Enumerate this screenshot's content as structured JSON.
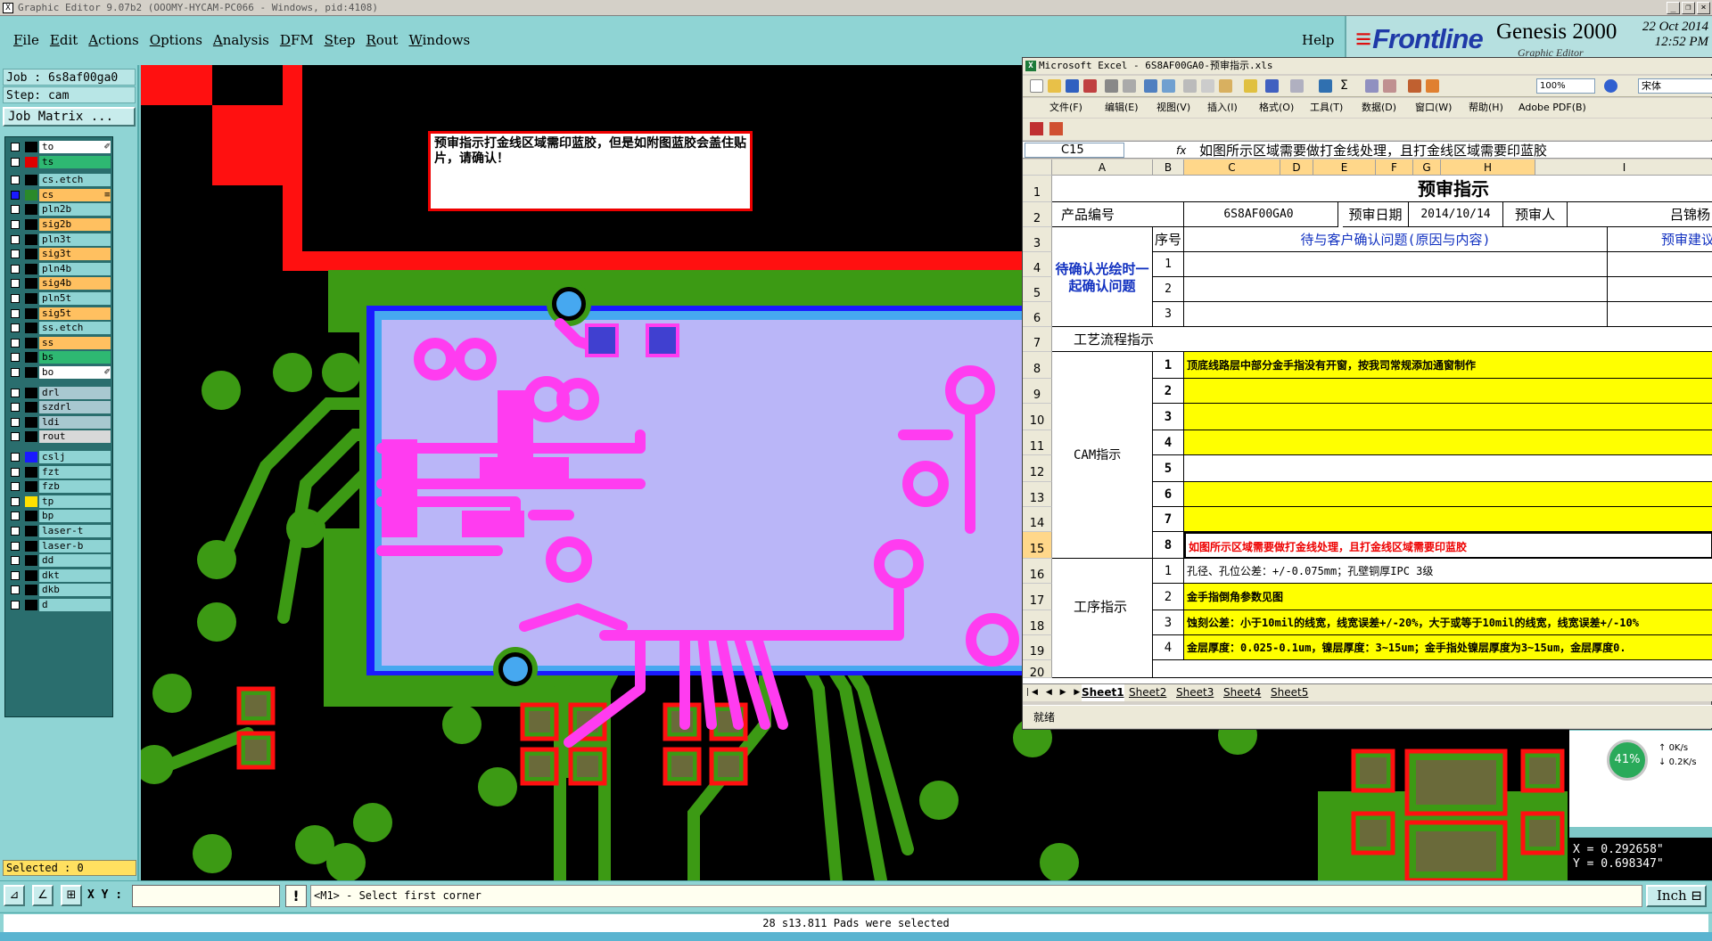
{
  "titlebar": {
    "text": "Graphic Editor 9.07b2 (OOOMY-HYCAM-PC066 - Windows, pid:4108)"
  },
  "menu": {
    "items": [
      {
        "label": "File",
        "key": "F",
        "rest": "ile"
      },
      {
        "label": "Edit",
        "key": "E",
        "rest": "dit"
      },
      {
        "label": "Actions",
        "key": "A",
        "rest": "ctions"
      },
      {
        "label": "Options",
        "key": "O",
        "rest": "ptions"
      },
      {
        "label": "Analysis",
        "key": "A",
        "rest": "nalysis"
      },
      {
        "label": "DFM",
        "key": "D",
        "rest": "FM"
      },
      {
        "label": "Step",
        "key": "S",
        "rest": "tep"
      },
      {
        "label": "Rout",
        "key": "R",
        "rest": "out"
      },
      {
        "label": "Windows",
        "key": "W",
        "rest": "indows"
      }
    ],
    "help": "Help"
  },
  "brand": {
    "logo": "Frontline",
    "product": "Genesis 2000",
    "subtitle": "Graphic Editor",
    "date": "22 Oct 2014",
    "time": "12:52 PM"
  },
  "job": {
    "job_line": "Job : 6s8af00ga0",
    "step_line": "Step: cam",
    "matrix_button": "Job Matrix ..."
  },
  "layers": [
    {
      "name": "to",
      "color": "#ffffff",
      "mark": "✐"
    },
    {
      "name": "ts",
      "color": "#2eb872",
      "swatch": "#e00000"
    },
    {
      "name": "cs.etch",
      "color": "#8fd4d4"
    },
    {
      "name": "cs",
      "color": "#ffc060",
      "swatch": "#2a8a2a",
      "mark": "≡",
      "active": true
    },
    {
      "name": "pln2b",
      "color": "#8fd4d4"
    },
    {
      "name": "sig2b",
      "color": "#ffc060"
    },
    {
      "name": "pln3t",
      "color": "#8fd4d4"
    },
    {
      "name": "sig3t",
      "color": "#ffc060"
    },
    {
      "name": "pln4b",
      "color": "#8fd4d4"
    },
    {
      "name": "sig4b",
      "color": "#ffc060"
    },
    {
      "name": "pln5t",
      "color": "#8fd4d4"
    },
    {
      "name": "sig5t",
      "color": "#ffc060"
    },
    {
      "name": "ss.etch",
      "color": "#8fd4d4"
    },
    {
      "name": "ss",
      "color": "#ffc060"
    },
    {
      "name": "bs",
      "color": "#2eb872"
    },
    {
      "name": "bo",
      "color": "#ffffff",
      "mark": "✐"
    },
    {
      "name": "drl",
      "color": "#a8c8d0"
    },
    {
      "name": "szdrl",
      "color": "#a8c8d0"
    },
    {
      "name": "ldi",
      "color": "#a8c8d0"
    },
    {
      "name": "rout",
      "color": "#d8d8d8"
    },
    {
      "name": "cslj",
      "color": "#8fd4d4",
      "swatch": "#1a1aff"
    },
    {
      "name": "fzt",
      "color": "#8fd4d4"
    },
    {
      "name": "fzb",
      "color": "#8fd4d4"
    },
    {
      "name": "tp",
      "color": "#8fd4d4",
      "swatch": "#ffe000"
    },
    {
      "name": "bp",
      "color": "#8fd4d4"
    },
    {
      "name": "laser-t",
      "color": "#8fd4d4"
    },
    {
      "name": "laser-b",
      "color": "#8fd4d4"
    },
    {
      "name": "dd",
      "color": "#8fd4d4"
    },
    {
      "name": "dkt",
      "color": "#8fd4d4"
    },
    {
      "name": "dkb",
      "color": "#8fd4d4"
    },
    {
      "name": "d",
      "color": "#8fd4d4"
    }
  ],
  "selected": "Selected : 0",
  "note": {
    "text": "预审指示打金线区域需印蓝胶，但是如附图蓝胶会盖住贴片，请确认！"
  },
  "excel": {
    "title": "Microsoft Excel - 6S8AF00GA0-预审指示.xls",
    "zoom": "100%",
    "font": "宋体",
    "menus": [
      "文件(F)",
      "编辑(E)",
      "视图(V)",
      "插入(I)",
      "格式(O)",
      "工具(T)",
      "数据(D)",
      "窗口(W)",
      "帮助(H)",
      "Adobe PDF(B)"
    ],
    "namebox": "C15",
    "fx": "fx",
    "formula": "如图所示区域需要做打金线处理，且打金线区域需要印蓝胶",
    "columns": [
      "A",
      "B",
      "C",
      "D",
      "E",
      "F",
      "G",
      "H",
      "I"
    ],
    "rows": [
      "1",
      "2",
      "3",
      "4",
      "5",
      "6",
      "7",
      "8",
      "9",
      "10",
      "11",
      "12",
      "13",
      "14",
      "15",
      "16",
      "17",
      "18",
      "19",
      "20"
    ],
    "cells": {
      "title": "预审指示",
      "prod_label": "产品编号",
      "prod_value": "6S8AF00GA0",
      "date_label": "预审日期",
      "date_value": "2014/10/14",
      "reviewer_label": "预审人",
      "reviewer_value": "吕锦杨",
      "seq_header": "序号",
      "question_header": "待与客户确认问题(原因与内容)",
      "suggest_header": "预审建议",
      "pending_label": "待确认光绘时一起确认问题",
      "process_label": "工艺流程指示",
      "cam_label": "CAM指示",
      "work_label": "工序指示",
      "q_nums": [
        "1",
        "2",
        "3"
      ],
      "cam_nums": [
        "1",
        "2",
        "3",
        "4",
        "5",
        "6",
        "7",
        "8"
      ],
      "cam_text_1": "顶底线路层中部分金手指没有开窗，按我司常规添加通窗制作",
      "cam_text_8": "如图所示区域需要做打金线处理，且打金线区域需要印蓝胶",
      "work_nums": [
        "1",
        "2",
        "3",
        "4"
      ],
      "work_1": "孔径、孔位公差：+/-0.075mm；孔壁铜厚IPC 3级",
      "work_2": "金手指倒角参数见图",
      "work_3": "蚀刻公差：小于10mil的线宽，线宽误差+/-20%，大于或等于10mil的线宽，线宽误差+/-10%",
      "work_4": "金层厚度：0.025-0.1um，镍层厚度：3~15um；金手指处镍层厚度为3~15um，金层厚度0."
    },
    "sheets": [
      "Sheet1",
      "Sheet2",
      "Sheet3",
      "Sheet4",
      "Sheet5"
    ],
    "status": "就绪"
  },
  "network": {
    "percent": "41%",
    "up": "0K/s",
    "down": "0.2K/s"
  },
  "coords": {
    "x": "X = 0.292658\"",
    "y": "Y = 0.698347\""
  },
  "bottom": {
    "xy_label": "X Y :",
    "xy_value": "",
    "excl": "!",
    "prompt": "<M1> - Select first corner",
    "units": "Inch"
  },
  "status": {
    "message": "28 s13.811 Pads were selected"
  },
  "colors": {
    "board_green": "#3c9a14",
    "pad_magenta": "#ff3cf0",
    "lavender": "#bab6f8",
    "outline_red": "#ff1010",
    "cyan": "#46a8f0",
    "yellow_row": "#ffff00"
  }
}
